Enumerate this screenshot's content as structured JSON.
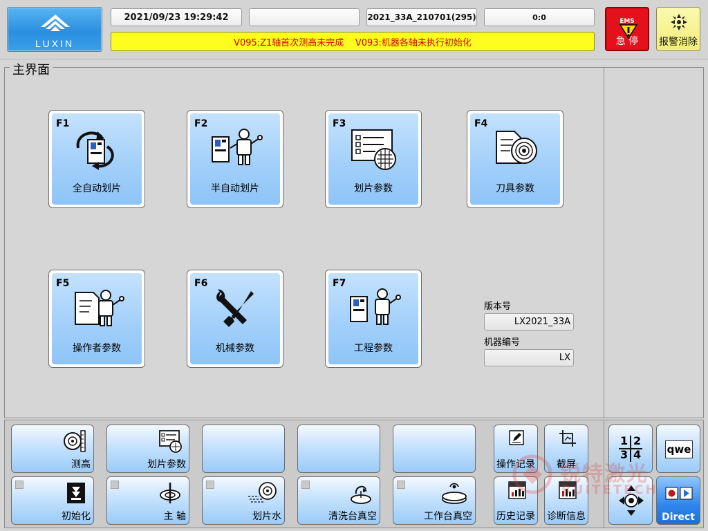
{
  "header": {
    "logo_text": "LUXIN",
    "datetime": "2021/09/23 19:29:42",
    "blank_field": "",
    "program": "2021_33A_210701(295)",
    "counter": "0:0",
    "alarm_text": "V095:Z1轴首次测高未完成    V093:机器各轴未执行初始化",
    "ems_top": "EMS",
    "ems_label": "急 停",
    "reset_label": "报警消除",
    "ems_color": "#e4101c",
    "alarm_bg": "#fefe1e",
    "alarm_color": "#d40000"
  },
  "main": {
    "title": "主界面",
    "function_buttons": [
      {
        "key": "F1",
        "label": "全自动划片",
        "icon": "auto-dicing-icon"
      },
      {
        "key": "F2",
        "label": "半自动划片",
        "icon": "semi-auto-dicing-icon"
      },
      {
        "key": "F3",
        "label": "划片参数",
        "icon": "dicing-params-icon"
      },
      {
        "key": "F4",
        "label": "刀具参数",
        "icon": "blade-params-icon"
      },
      {
        "key": "F5",
        "label": "操作者参数",
        "icon": "operator-params-icon"
      },
      {
        "key": "F6",
        "label": "机械参数",
        "icon": "mechanical-params-icon"
      },
      {
        "key": "F7",
        "label": "工程参数",
        "icon": "engineering-params-icon"
      }
    ],
    "version_label": "版本号",
    "version_value": "LX2021_33A",
    "machine_label": "机器编号",
    "machine_value": "LX"
  },
  "bottom": {
    "row1": [
      {
        "label": "测高",
        "icon": "height-measure-icon"
      },
      {
        "label": "划片参数",
        "icon": "dicing-params-icon"
      },
      {
        "label": "",
        "icon": ""
      },
      {
        "label": "",
        "icon": ""
      },
      {
        "label": "",
        "icon": ""
      }
    ],
    "row2": [
      {
        "label": "初始化",
        "icon": "initialize-icon"
      },
      {
        "label": "主 轴",
        "icon": "spindle-icon"
      },
      {
        "label": "划片水",
        "icon": "dicing-water-icon"
      },
      {
        "label": "清洗台真空",
        "icon": "clean-table-vacuum-icon"
      },
      {
        "label": "工作台真空",
        "icon": "work-table-vacuum-icon"
      }
    ],
    "small": [
      {
        "label": "操作记录",
        "icon": "operation-log-icon"
      },
      {
        "label": "截屏",
        "icon": "screenshot-icon"
      },
      {
        "label": "历史记录",
        "icon": "history-icon"
      },
      {
        "label": "诊断信息",
        "icon": "diagnostics-icon"
      }
    ],
    "keypad_digits": [
      "1",
      "2",
      "3",
      "4"
    ],
    "keyboard_label": "qwe",
    "direct_label": "Direct"
  },
  "watermark": {
    "cn": "锐特激光",
    "en": "RUITETECH"
  }
}
